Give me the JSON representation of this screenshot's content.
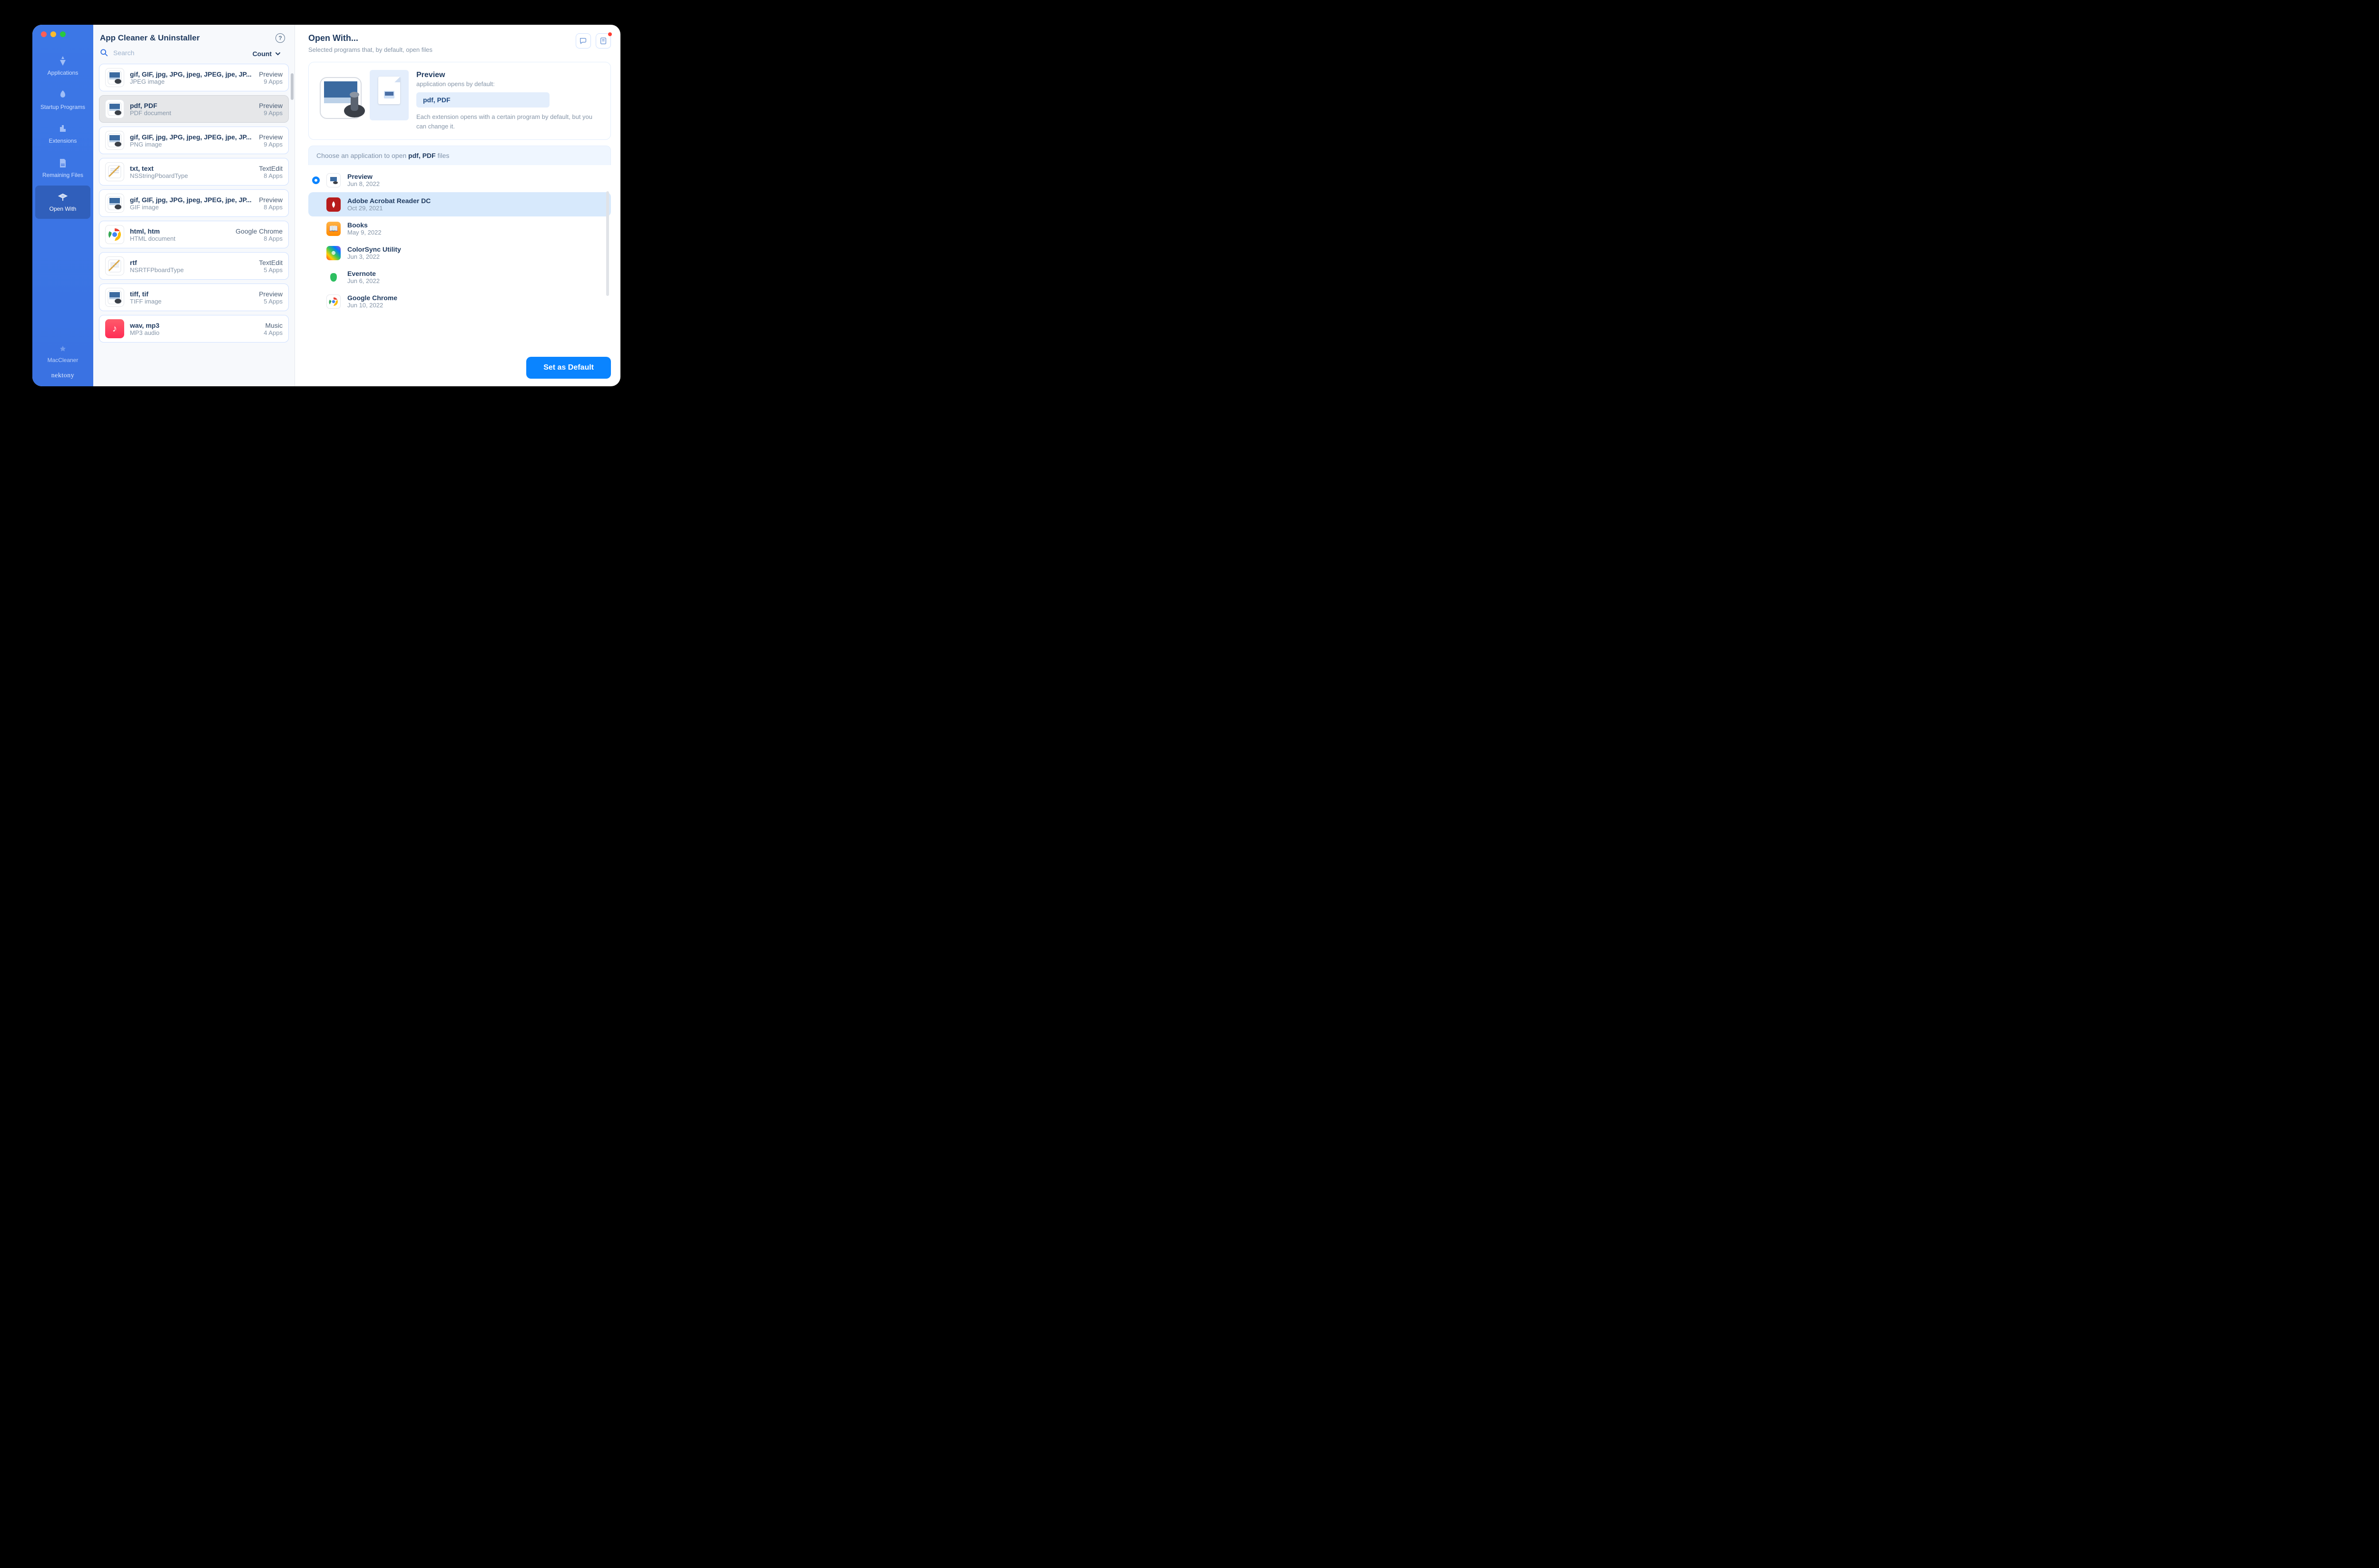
{
  "traffic": {
    "close": "#ff5f57",
    "min": "#febc2e",
    "max": "#28c840"
  },
  "header": {
    "title": "App Cleaner & Uninstaller",
    "search_placeholder": "Search",
    "sort_label": "Count"
  },
  "sidebar": {
    "items": [
      {
        "label": "Applications"
      },
      {
        "label": "Startup Programs"
      },
      {
        "label": "Extensions"
      },
      {
        "label": "Remaining Files"
      },
      {
        "label": "Open With",
        "active": true
      }
    ],
    "brand_upper": "MacCleaner",
    "brand_lower": "nektony"
  },
  "types": [
    {
      "exts": "gif, GIF, jpg, JPG, jpeg, JPEG, jpe, JP...",
      "desc": "JPEG image",
      "app": "Preview",
      "count": "9 Apps",
      "kind": "prev"
    },
    {
      "exts": "pdf, PDF",
      "desc": "PDF document",
      "app": "Preview",
      "count": "9 Apps",
      "kind": "prev",
      "selected": true
    },
    {
      "exts": "gif, GIF, jpg, JPG, jpeg, JPEG, jpe, JP...",
      "desc": "PNG image",
      "app": "Preview",
      "count": "9 Apps",
      "kind": "prev"
    },
    {
      "exts": "txt, text",
      "desc": "NSStringPboardType",
      "app": "TextEdit",
      "count": "8 Apps",
      "kind": "te"
    },
    {
      "exts": "gif, GIF, jpg, JPG, jpeg, JPEG, jpe, JP...",
      "desc": "GIF image",
      "app": "Preview",
      "count": "8 Apps",
      "kind": "prev"
    },
    {
      "exts": "html, htm",
      "desc": "HTML document",
      "app": "Google Chrome",
      "count": "8 Apps",
      "kind": "gc"
    },
    {
      "exts": "rtf",
      "desc": "NSRTFPboardType",
      "app": "TextEdit",
      "count": "5 Apps",
      "kind": "te"
    },
    {
      "exts": "tiff, tif",
      "desc": "TIFF image",
      "app": "Preview",
      "count": "5 Apps",
      "kind": "prev"
    },
    {
      "exts": "wav, mp3",
      "desc": "MP3 audio",
      "app": "Music",
      "count": "4 Apps",
      "kind": "mu"
    }
  ],
  "detail": {
    "title": "Open With...",
    "subtitle": "Selected programs that, by default, open files",
    "hero_title": "Preview",
    "hero_subtitle": "application opens by default:",
    "hero_badge": "pdf, PDF",
    "hero_desc": "Each extension opens with a certain program by default, but you can change it.",
    "choose_prefix": "Choose an application to open ",
    "choose_ext": "pdf, PDF",
    "choose_suffix": " files",
    "set_default": "Set as Default"
  },
  "apps": [
    {
      "name": "Preview",
      "date": "Jun 8, 2022",
      "selected": true,
      "icon": "prev"
    },
    {
      "name": "Adobe Acrobat Reader DC",
      "date": "Oct 29, 2021",
      "hover": true,
      "icon": "acro"
    },
    {
      "name": "Books",
      "date": "May 9, 2022",
      "icon": "books"
    },
    {
      "name": "ColorSync Utility",
      "date": "Jun 3, 2022",
      "icon": "cs"
    },
    {
      "name": "Evernote",
      "date": "Jun 6, 2022",
      "icon": "ev"
    },
    {
      "name": "Google Chrome",
      "date": "Jun 10, 2022",
      "icon": "gc"
    }
  ]
}
